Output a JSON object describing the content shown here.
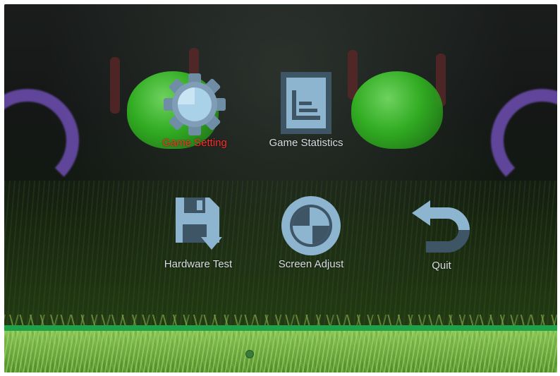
{
  "menu": {
    "items": [
      {
        "label": "Game Setting",
        "icon": "gear-icon",
        "selected": true
      },
      {
        "label": "Game Statistics",
        "icon": "statistics-icon",
        "selected": false
      },
      {
        "label": "Hardware Test",
        "icon": "save-download-icon",
        "selected": false
      },
      {
        "label": "Screen Adjust",
        "icon": "screen-adjust-icon",
        "selected": false
      },
      {
        "label": "Quit",
        "icon": "undo-arrow-icon",
        "selected": false
      }
    ]
  },
  "colors": {
    "selected_label": "#ff2a2a",
    "label": "#d7dde2",
    "icon_light": "#a9d1e8",
    "icon_dark": "#3e5566",
    "bezel": "#1fa14a"
  }
}
